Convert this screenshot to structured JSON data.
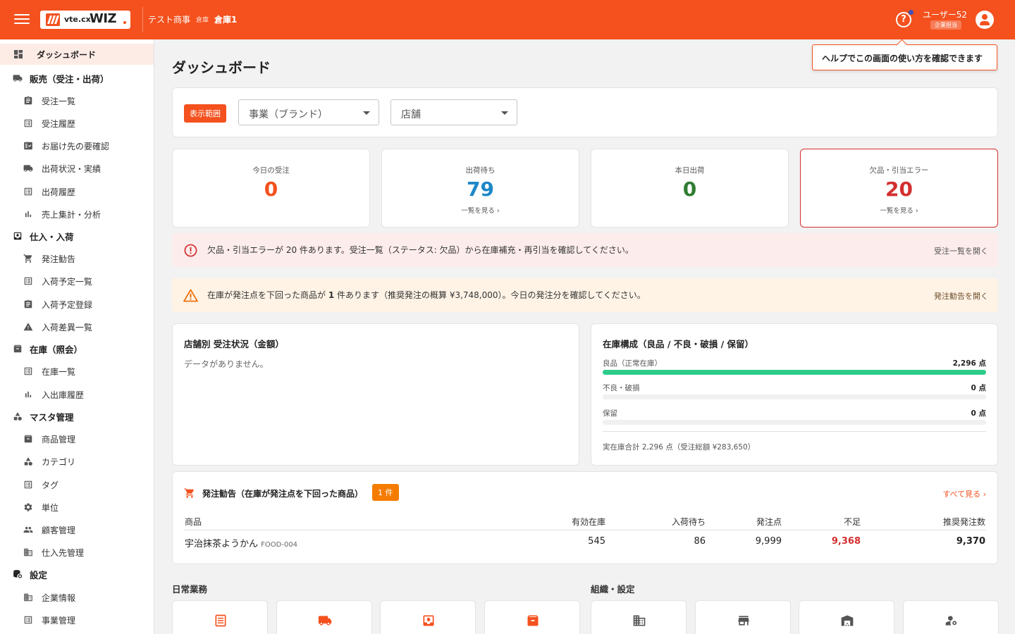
{
  "header": {
    "logo_small": "vte.cx",
    "logo_big": "WIZ",
    "company": "テスト商事",
    "warehouse_label": "倉庫",
    "warehouse": "倉庫1",
    "help_icon": "help-circle-icon",
    "user_name": "ユーザー52",
    "user_role": "企業担当"
  },
  "sidebar": {
    "items": [
      {
        "label": "ダッシュボード",
        "icon": "dashboard-icon",
        "kind": "top"
      },
      {
        "label": "販売（受注・出荷）",
        "icon": "truck-icon",
        "kind": "sec"
      },
      {
        "label": "受注一覧",
        "icon": "clipboard-icon",
        "kind": "sub"
      },
      {
        "label": "受注履歴",
        "icon": "list-icon",
        "kind": "sub"
      },
      {
        "label": "お届け先の要確認",
        "icon": "checklist-icon",
        "kind": "sub"
      },
      {
        "label": "出荷状況・実績",
        "icon": "truck-icon",
        "kind": "sub"
      },
      {
        "label": "出荷履歴",
        "icon": "list-icon",
        "kind": "sub"
      },
      {
        "label": "売上集計・分析",
        "icon": "bar-chart-icon",
        "kind": "sub"
      },
      {
        "label": "仕入・入荷",
        "icon": "inbox-icon",
        "kind": "sec"
      },
      {
        "label": "発注勧告",
        "icon": "cart-icon",
        "kind": "sub"
      },
      {
        "label": "入荷予定一覧",
        "icon": "list-icon",
        "kind": "sub"
      },
      {
        "label": "入荷予定登録",
        "icon": "clipboard-icon",
        "kind": "sub"
      },
      {
        "label": "入荷差異一覧",
        "icon": "warning-icon",
        "kind": "sub"
      },
      {
        "label": "在庫（照会）",
        "icon": "archive-icon",
        "kind": "sec"
      },
      {
        "label": "在庫一覧",
        "icon": "list-icon",
        "kind": "sub"
      },
      {
        "label": "入出庫履歴",
        "icon": "bar-chart-icon",
        "kind": "sub"
      },
      {
        "label": "マスタ管理",
        "icon": "shapes-icon",
        "kind": "sec"
      },
      {
        "label": "商品管理",
        "icon": "archive-icon",
        "kind": "sub"
      },
      {
        "label": "カテゴリ",
        "icon": "shapes-icon",
        "kind": "sub"
      },
      {
        "label": "タグ",
        "icon": "list-icon",
        "kind": "sub"
      },
      {
        "label": "単位",
        "icon": "gear-icon",
        "kind": "sub"
      },
      {
        "label": "顧客管理",
        "icon": "people-icon",
        "kind": "sub"
      },
      {
        "label": "仕入先管理",
        "icon": "building-icon",
        "kind": "sub"
      },
      {
        "label": "設定",
        "icon": "settings-db-icon",
        "kind": "sec"
      },
      {
        "label": "企業情報",
        "icon": "building-icon",
        "kind": "sub"
      },
      {
        "label": "事業管理",
        "icon": "list-icon",
        "kind": "sub"
      }
    ]
  },
  "main": {
    "title": "ダッシュボード",
    "tooltip": "ヘルプでこの画面の使い方を確認できます",
    "filter": {
      "badge": "表示範囲",
      "business_placeholder": "事業（ブランド）",
      "store_placeholder": "店舗"
    },
    "kpis": [
      {
        "label": "今日の受注",
        "value": "0",
        "link": "",
        "color": "#f4511e"
      },
      {
        "label": "出荷待ち",
        "value": "79",
        "link": "一覧を見る ›",
        "color": "#1e88c8"
      },
      {
        "label": "本日出荷",
        "value": "0",
        "link": "",
        "color": "#2e7d32"
      },
      {
        "label": "欠品・引当エラー",
        "value": "20",
        "link": "一覧を見る ›",
        "color": "#d32f2f"
      }
    ],
    "alerts": {
      "error_text": "欠品・引当エラーが 20 件あります。受注一覧（ステータス: 欠品）から在庫補充・再引当を確認してください。",
      "error_link": "受注一覧を開く",
      "warn_text_pre": "在庫が発注点を下回った商品が ",
      "warn_count": "1",
      "warn_text_post": " 件あります（推奨発注の概算 ¥3,748,000）。今日の発注分を確認してください。",
      "warn_link": "発注勧告を開く"
    },
    "store_orders": {
      "title": "店舗別 受注状況（金額）",
      "empty": "データがありません。"
    },
    "inventory": {
      "title": "在庫構成（良品 / 不良・破損 / 保留）",
      "rows": [
        {
          "label": "良品（正常在庫）",
          "value": "2,296 点",
          "fraction": 1.0
        },
        {
          "label": "不良・破損",
          "value": "0 点",
          "fraction": 0
        },
        {
          "label": "保留",
          "value": "0 点",
          "fraction": 0
        }
      ],
      "footer": "実在庫合計 2,296 点（受注総額 ¥283,650）"
    },
    "reorder": {
      "title": "発注勧告（在庫が発注点を下回った商品）",
      "count_badge": "1 件",
      "see_all": "すべて見る ›",
      "columns": [
        "商品",
        "有効在庫",
        "入荷待ち",
        "発注点",
        "不足",
        "推奨発注数"
      ],
      "rows": [
        {
          "name": "宇治抹茶ようかん",
          "code": "FOOD-004",
          "available": "545",
          "incoming": "86",
          "reorder_point": "9,999",
          "shortage": "9,368",
          "recommended": "9,370"
        }
      ]
    },
    "daily_title": "日常業務",
    "org_title": "組織・設定"
  },
  "colors": {
    "accent": "#f4511e",
    "danger": "#d32f2f",
    "info": "#1e88c8",
    "success": "#2e7d32",
    "bar": "#2ecc8a"
  }
}
